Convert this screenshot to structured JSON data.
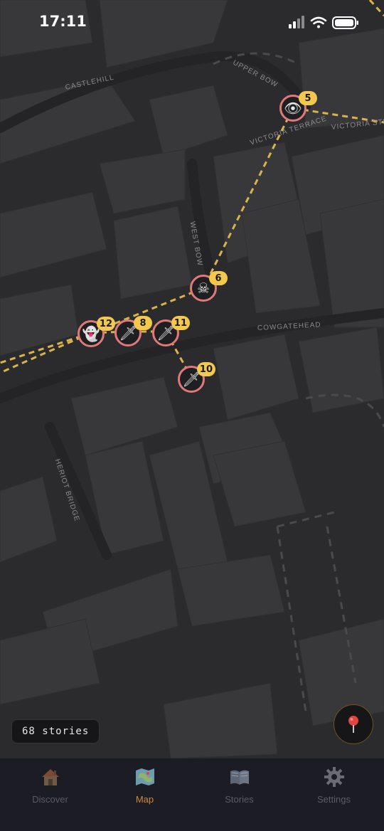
{
  "status_bar": {
    "time": "17:11"
  },
  "map": {
    "street_labels": {
      "castlehill": "CASTLEHILL",
      "upper_bow": "UPPER BOW",
      "victoria_terrace": "VICTORIA TERRACE",
      "victoria_street": "VICTORIA STR",
      "west_bow": "WEST BOW",
      "cowgatehead": "COWGATEHEAD",
      "heriot_bridge": "HERIOT BRIDGE"
    },
    "markers": [
      {
        "icon": "eye-icon",
        "glyph": "👁",
        "count": "5"
      },
      {
        "icon": "skull-icon",
        "glyph": "☠",
        "count": "6"
      },
      {
        "icon": "ghost-icon",
        "glyph": "👻",
        "count": "12"
      },
      {
        "icon": "dagger-icon",
        "glyph": "🗡",
        "count": "8"
      },
      {
        "icon": "dagger-icon",
        "glyph": "🗡",
        "count": "11"
      },
      {
        "icon": "dagger-icon",
        "glyph": "🗡",
        "count": "10"
      }
    ],
    "story_count": "68 stories"
  },
  "tabs": [
    {
      "label": "Discover",
      "icon": "house-icon",
      "active": false
    },
    {
      "label": "Map",
      "icon": "map-icon",
      "active": true
    },
    {
      "label": "Stories",
      "icon": "book-icon",
      "active": false
    },
    {
      "label": "Settings",
      "icon": "gear-icon",
      "active": false
    }
  ],
  "colors": {
    "map_background": "#2b2b2d",
    "route_line": "#d9b44a",
    "marker_ring": "#e07a7a",
    "badge": "#f2c94c",
    "active_tab": "#c98a3a",
    "tab_bar": "#1c1c25"
  }
}
